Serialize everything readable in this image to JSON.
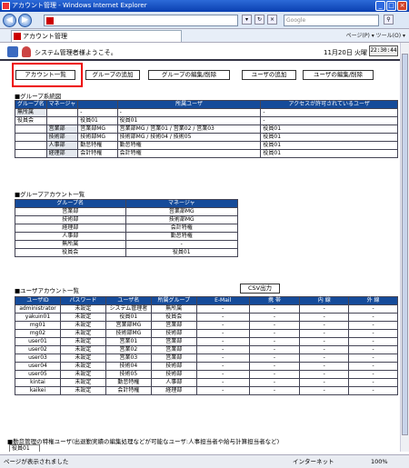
{
  "browser": {
    "title": "アカウント管理 - Windows Internet Explorer",
    "search_placeholder": "Google",
    "tab_title": "アカウント管理",
    "toolbar_text": "ページ(P) ▾  ツール(O) ▾",
    "status": "ページが表示されました",
    "zone": "インターネット",
    "zoom": "100%"
  },
  "header": {
    "welcome": "システム管理者様ようこそ。",
    "date": "11月20日 火曜",
    "time": "22:30:44"
  },
  "nav": [
    "アカウント一覧",
    "グループの追加",
    "グループの編集/削除",
    "ユーザの追加",
    "ユーザの編集/削除"
  ],
  "group_tree": {
    "title": "■グループ系統図",
    "headers": [
      "グループ名",
      "マネージャ",
      "所属ユーザ",
      "アクセスが許可されているユーザ"
    ],
    "rows": [
      [
        "無所属",
        "",
        "-",
        "-",
        "-"
      ],
      [
        "役員会",
        "",
        "役員01",
        "役員01",
        "-"
      ],
      [
        "",
        "営業部",
        "営業部MG",
        "営業部MG / 営業01 / 営業02 / 営業03",
        "役員01"
      ],
      [
        "",
        "技術部",
        "技術部MG",
        "技術部MG / 技術04 / 技術05",
        "役員01"
      ],
      [
        "",
        "人事部",
        "勤怠特権",
        "勤怠特権",
        "役員01"
      ],
      [
        "",
        "経理部",
        "会計特権",
        "会計特権",
        "役員01"
      ]
    ]
  },
  "group_accounts": {
    "title": "■グループアカウント一覧",
    "headers": [
      "グループ名",
      "マネージャ"
    ],
    "rows": [
      [
        "営業部",
        "営業部MG"
      ],
      [
        "技術部",
        "技術部MG"
      ],
      [
        "経理部",
        "会計特権"
      ],
      [
        "人事部",
        "勤怠特権"
      ],
      [
        "無所属",
        "-"
      ],
      [
        "役員会",
        "役員01"
      ]
    ]
  },
  "user_accounts": {
    "title": "■ユーザアカウント一覧",
    "csv_button": "CSV出力",
    "headers": [
      "ユーザID",
      "パスワード",
      "ユーザ名",
      "所属グループ",
      "E-Mail",
      "携 帯",
      "内 線",
      "外 線"
    ],
    "rows": [
      [
        "administrator",
        "未設定",
        "システム管理者",
        "無所属",
        "-",
        "-",
        "-",
        "-"
      ],
      [
        "yakuin01",
        "未設定",
        "役員01",
        "役員会",
        "-",
        "-",
        "-",
        "-"
      ],
      [
        "mg01",
        "未設定",
        "営業部MG",
        "営業部",
        "-",
        "-",
        "-",
        "-"
      ],
      [
        "mg02",
        "未設定",
        "技術部MG",
        "技術部",
        "-",
        "-",
        "-",
        "-"
      ],
      [
        "user01",
        "未設定",
        "営業01",
        "営業部",
        "-",
        "-",
        "-",
        "-"
      ],
      [
        "user02",
        "未設定",
        "営業02",
        "営業部",
        "-",
        "-",
        "-",
        "-"
      ],
      [
        "user03",
        "未設定",
        "営業03",
        "営業部",
        "-",
        "-",
        "-",
        "-"
      ],
      [
        "user04",
        "未設定",
        "技術04",
        "技術部",
        "-",
        "-",
        "-",
        "-"
      ],
      [
        "user05",
        "未設定",
        "技術05",
        "技術部",
        "-",
        "-",
        "-",
        "-"
      ],
      [
        "kintai",
        "未設定",
        "勤怠特権",
        "人事部",
        "-",
        "-",
        "-",
        "-"
      ],
      [
        "kaikei",
        "未設定",
        "会計特権",
        "経理部",
        "-",
        "-",
        "-",
        "-"
      ]
    ]
  },
  "privileged": {
    "title": "■勤怠管理の特権ユーザ(出退勤実績の編集処理などが可能なユーザ:人事担当者や給与計算担当者など)",
    "value": "役員01"
  }
}
